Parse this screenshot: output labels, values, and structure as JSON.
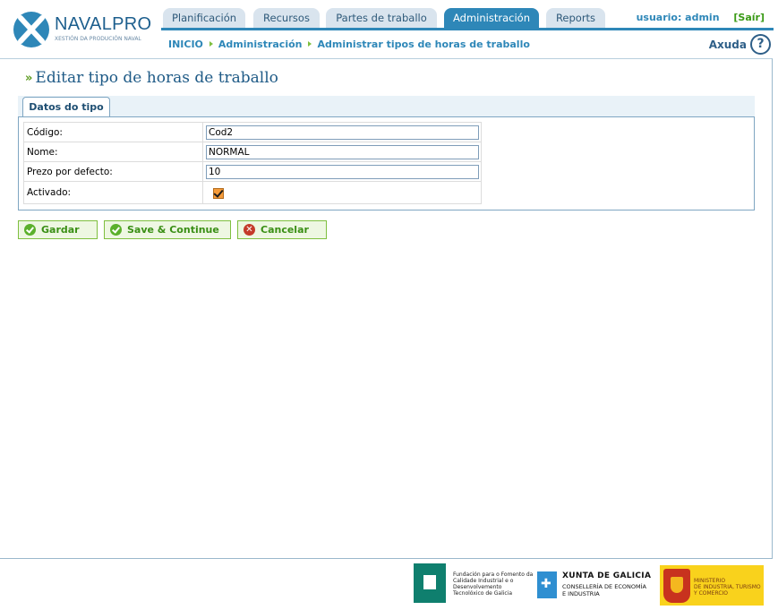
{
  "app": {
    "brand": "NAVALPRO",
    "tagline": "XESTIÓN DA PRODUCIÓN NAVAL"
  },
  "nav": {
    "tabs": [
      {
        "label": "Planificación",
        "active": false
      },
      {
        "label": "Recursos",
        "active": false
      },
      {
        "label": "Partes de traballo",
        "active": false
      },
      {
        "label": "Administración",
        "active": true
      },
      {
        "label": "Reports",
        "active": false
      }
    ]
  },
  "user": {
    "label": "usuario: admin",
    "logout": "[Saír]"
  },
  "breadcrumb": [
    "INICIO",
    "Administración",
    "Administrar tipos de horas de traballo"
  ],
  "help": {
    "label": "Axuda",
    "icon": "help-question-icon",
    "glyph": "?"
  },
  "page": {
    "title": "Editar tipo de horas de traballo",
    "section_tab": "Datos do tipo"
  },
  "form": {
    "code_label": "Código:",
    "code_value": "Cod2",
    "name_label": "Nome:",
    "name_value": "NORMAL",
    "price_label": "Prezo por defecto:",
    "price_value": "10",
    "enabled_label": "Activado:",
    "enabled_value": true
  },
  "buttons": {
    "save": "Gardar",
    "save_continue": "Save & Continue",
    "cancel": "Cancelar",
    "cancel_glyph": "✕"
  },
  "footer": {
    "fundacion": "Fundación para o Fomento da Calidade Industrial e o Desenvolvemento Tecnolóxico de Galicia",
    "xunta_title": "XUNTA DE GALICIA",
    "xunta_sub1": "CONSELLERÍA DE ECONOMÍA",
    "xunta_sub2": "E INDUSTRIA",
    "ministerio1": "MINISTERIO",
    "ministerio2": "DE INDUSTRIA, TURISMO",
    "ministerio3": "Y COMERCIO"
  },
  "colors": {
    "primary": "#2e87b8",
    "accent_green": "#3a8f15",
    "title_blue": "#1e5a86"
  }
}
